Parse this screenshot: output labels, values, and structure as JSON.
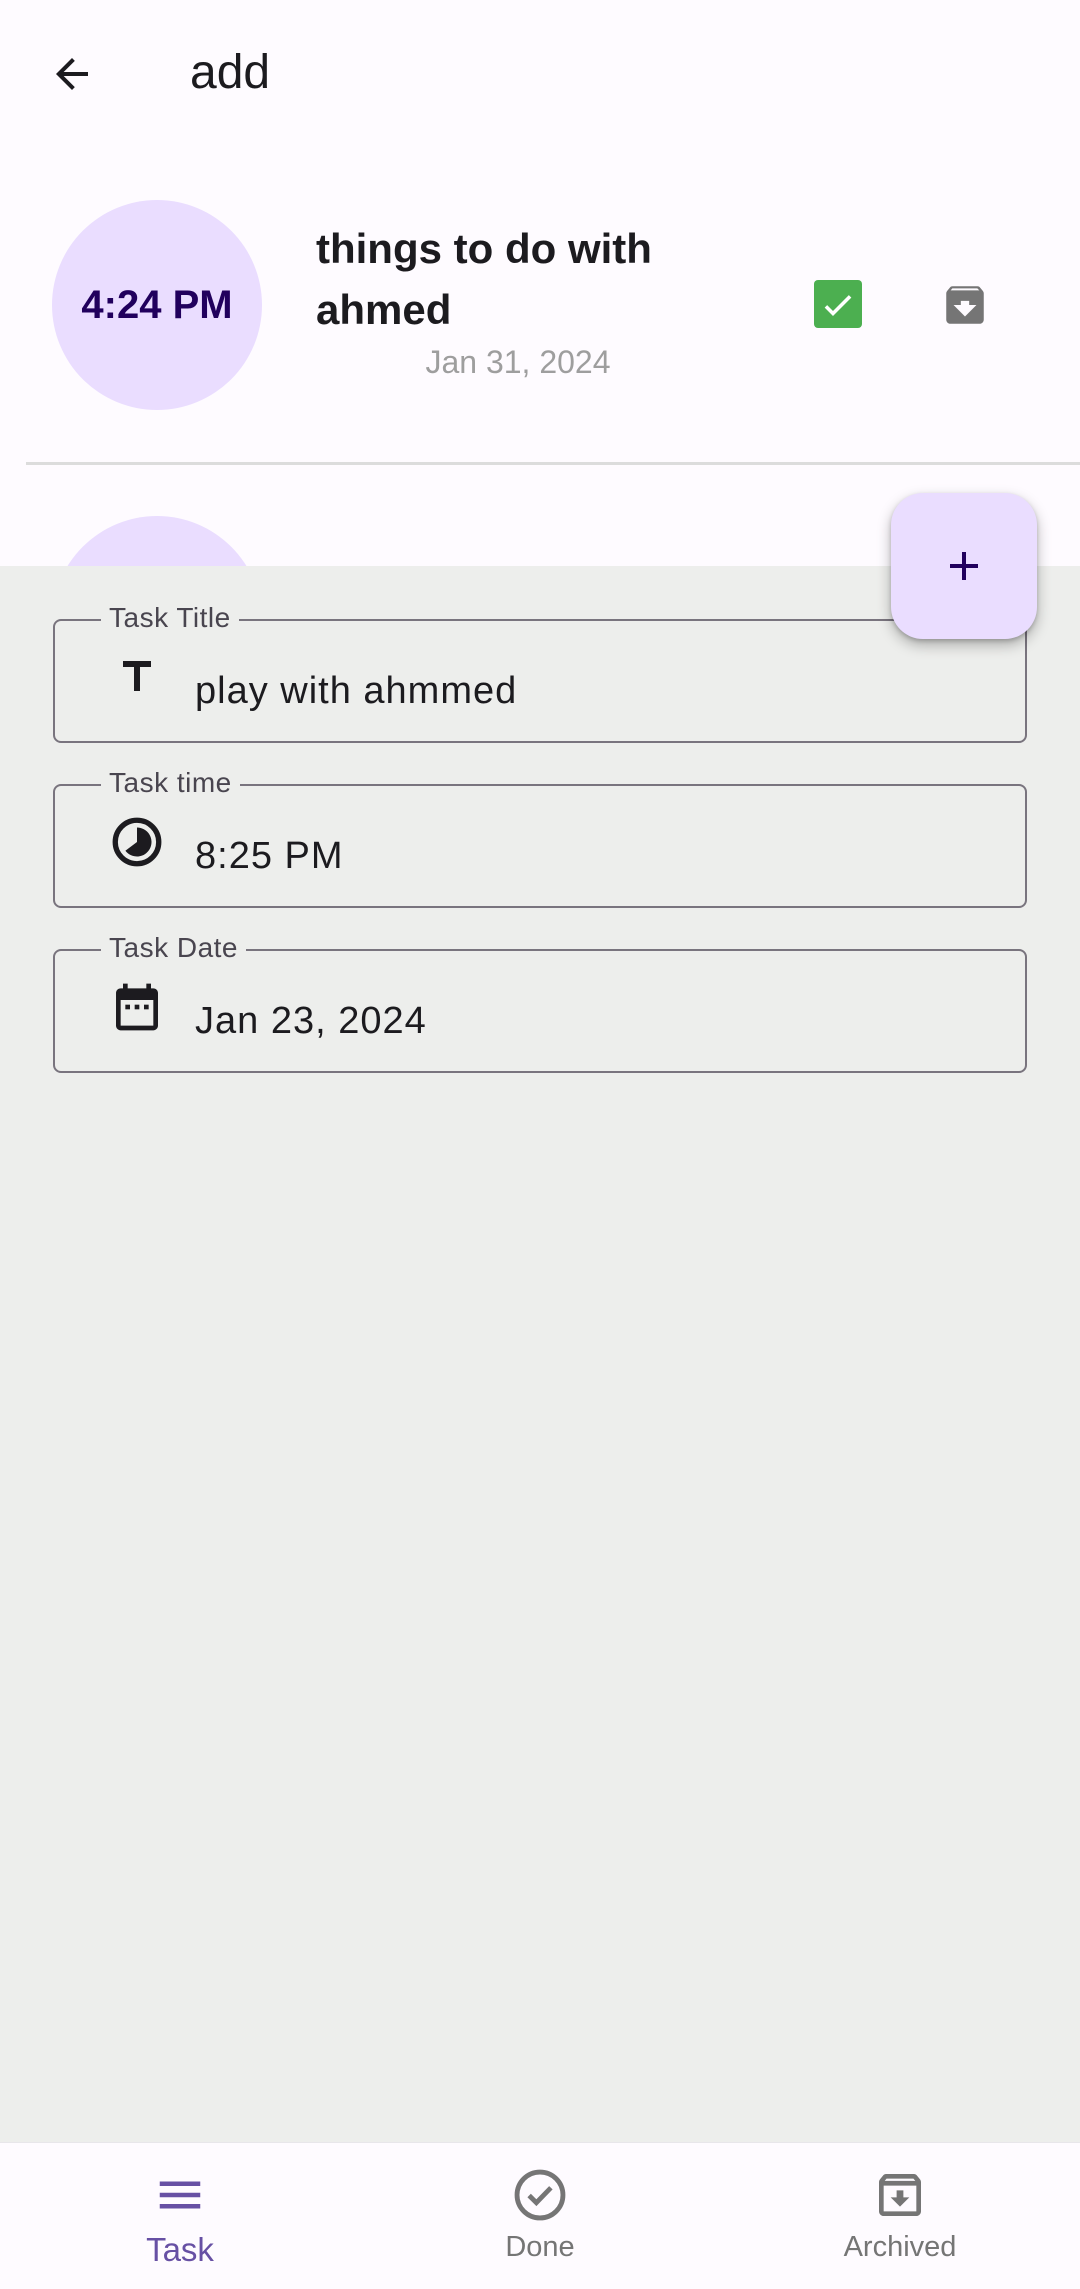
{
  "app_bar": {
    "title": "add",
    "back_icon": "arrow-back-icon"
  },
  "task_list": {
    "items": [
      {
        "time": "4:24 PM",
        "title": "things to do with ahmed",
        "date": "Jan 31, 2024",
        "done_icon": "check-box-icon",
        "archive_icon": "archive-icon"
      }
    ]
  },
  "form": {
    "title_field": {
      "label": "Task Title",
      "value": "play with ahmmed",
      "icon": "title-icon"
    },
    "time_field": {
      "label": "Task time",
      "value": "8:25 PM",
      "icon": "clock-icon"
    },
    "date_field": {
      "label": "Task Date",
      "value": "Jan 23, 2024",
      "icon": "calendar-icon"
    }
  },
  "fab": {
    "icon": "add-icon"
  },
  "bottom_nav": {
    "items": [
      {
        "label": "Task",
        "icon": "menu-icon",
        "active": true
      },
      {
        "label": "Done",
        "icon": "check-circle-icon",
        "active": false
      },
      {
        "label": "Archived",
        "icon": "archive-icon",
        "active": false
      }
    ]
  },
  "colors": {
    "primary": "#6750a4",
    "avatar_bg": "#eaddff",
    "check_green": "#4caf50",
    "sheet_bg": "#edeeec"
  }
}
